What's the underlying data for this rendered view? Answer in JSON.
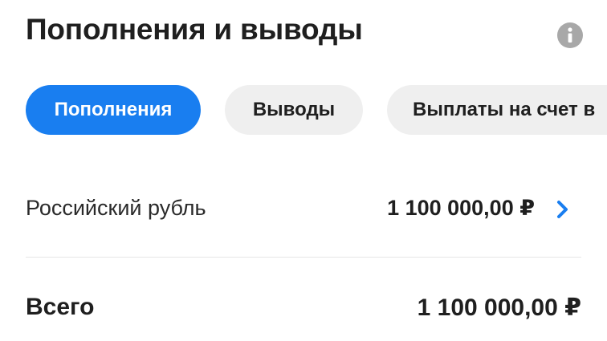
{
  "header": {
    "title": "Пополнения и выводы",
    "info_icon": "info-icon"
  },
  "tabs": [
    {
      "label": "Пополнения",
      "active": true
    },
    {
      "label": "Выводы",
      "active": false
    },
    {
      "label": "Выплаты на счет в",
      "active": false
    }
  ],
  "rows": {
    "currency": {
      "label": "Российский рубль",
      "amount": "1 100 000,00 ₽",
      "icon": "chevron-right-icon"
    },
    "total": {
      "label": "Всего",
      "amount": "1 100 000,00 ₽"
    }
  },
  "colors": {
    "accent": "#197ef0",
    "tab_inactive": "#efefef",
    "info_icon": "#a8a8a8",
    "text": "#1f1f1f"
  }
}
